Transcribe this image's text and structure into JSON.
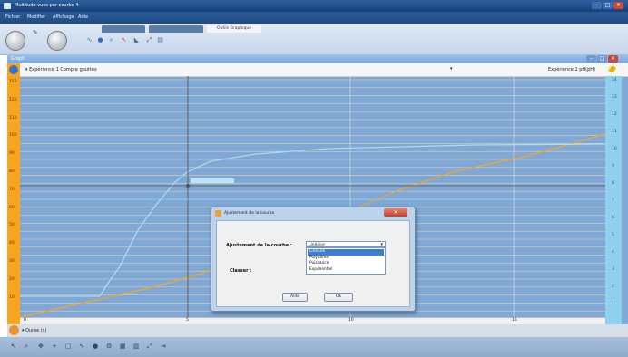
{
  "window": {
    "title": "Multitude vues par courbe 4",
    "buttons": [
      "–",
      "□",
      "✕"
    ]
  },
  "menubar": {
    "items": [
      "Fichier",
      "Modifier",
      "Affichage",
      "Aide"
    ]
  },
  "ribbon": {
    "tabs": [
      {
        "label": "",
        "active": false
      },
      {
        "label": "",
        "active": false
      },
      {
        "label": "Outils Graphique",
        "active": true
      }
    ],
    "tool_icons": [
      "curve-icon",
      "palette-icon",
      "zoom-icon",
      "cursor-icon",
      "tangent-icon",
      "measure-icon",
      "table-icon"
    ]
  },
  "graph_window": {
    "title": "Graph",
    "buttons": [
      "–",
      "□",
      "✕"
    ]
  },
  "curve_bar": {
    "left_selector": "Expérience 1 Compte gouttes",
    "right_selector": "Expérience 1 pH(pH)"
  },
  "left_axis": {
    "ticks": [
      "150",
      "120",
      "110",
      "100",
      "90",
      "80",
      "70",
      "60",
      "50",
      "40",
      "30",
      "20",
      "10"
    ]
  },
  "right_axis": {
    "ticks": [
      "14",
      "13",
      "12",
      "11",
      "10",
      "9",
      "8",
      "7",
      "6",
      "5",
      "4",
      "3",
      "2",
      "1"
    ]
  },
  "x_axis": {
    "ticks": [
      "0",
      "5",
      "10",
      "15"
    ],
    "label": "Durée (s)"
  },
  "colors": {
    "orange_series": "#f7a51f",
    "blue_series": "#8fd0ef",
    "accent": "#3d7fd6"
  },
  "dialog": {
    "title": "Ajustement de la courbe",
    "fit_label": "Ajustement de la courbe :",
    "class_label": "Classer :",
    "selected": "Linéaire",
    "options": [
      "Linéaire",
      "Polynôme",
      "Puissance",
      "Exponentiel"
    ],
    "help_button": "Aide",
    "ok_button": "Ok"
  },
  "bottom_strip": {
    "label": "Durée (s)"
  },
  "status_icons": [
    "select-icon",
    "zoom-icon",
    "pan-icon",
    "add-icon",
    "crop-icon",
    "curve-icon",
    "point-icon",
    "settings-icon",
    "grid-icon",
    "chart-icon",
    "measure-icon",
    "export-icon"
  ]
}
